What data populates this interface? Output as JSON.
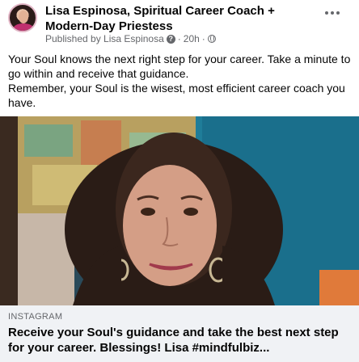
{
  "post": {
    "author": "Lisa Espinosa, Spiritual Career Coach + Modern-Day Priestess",
    "meta": {
      "published_by": "Published by Lisa Espinosa",
      "help_glyph": "?",
      "time": "20h",
      "separator": "·",
      "audience_icon": "globe-icon"
    },
    "message_lines": [
      "Your Soul knows the next right step for your career. Take a minute to go within and receive that guidance.",
      "Remember, your Soul is the wisest, most efficient career coach you have."
    ],
    "link_preview": {
      "source": "INSTAGRAM",
      "title": "Receive your Soul's guidance and take the best next step for your career. Blessings! Lisa #mindfulbiz..."
    }
  },
  "colors": {
    "text_primary": "#050505",
    "text_secondary": "#65676b",
    "caption_bg": "#f0f2f5",
    "background_teal": "#1f7d99"
  }
}
